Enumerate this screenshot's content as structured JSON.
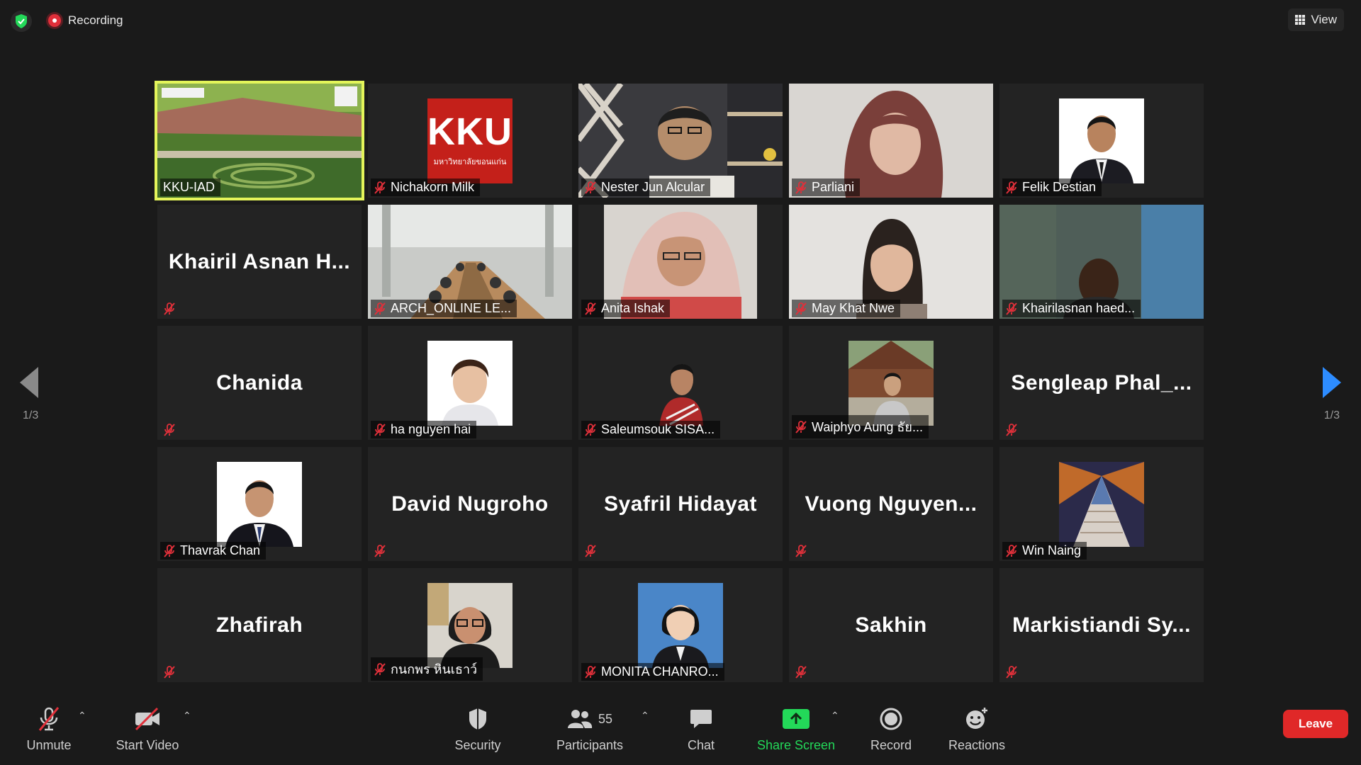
{
  "header": {
    "recording_label": "Recording",
    "view_label": "View"
  },
  "pagination": {
    "left": "1/3",
    "right": "1/3"
  },
  "participants": [
    {
      "name": "KKU-IAD",
      "kind": "video"
    },
    {
      "name": "Nichakorn Milk",
      "kind": "logo",
      "logo_text": "KKU",
      "logo_sub": "มหาวิทยาลัยขอนแก่น"
    },
    {
      "name": "Nester Jun Alcular",
      "kind": "video"
    },
    {
      "name": "Parliani",
      "kind": "video"
    },
    {
      "name": "Felik Destian",
      "kind": "photo"
    },
    {
      "name": "",
      "kind": "text",
      "display": "Khairil Asnan H..."
    },
    {
      "name": "ARCH_ONLINE LE...",
      "kind": "video"
    },
    {
      "name": "Anita Ishak",
      "kind": "video"
    },
    {
      "name": "May Khat Nwe",
      "kind": "video"
    },
    {
      "name": "Khairilasnan haed...",
      "kind": "video"
    },
    {
      "name": "",
      "kind": "text",
      "display": "Chanida"
    },
    {
      "name": "ha nguyen hai",
      "kind": "photo"
    },
    {
      "name": "Saleumsouk SISA...",
      "kind": "photo"
    },
    {
      "name": "Waiphyo Aung ธัย...",
      "kind": "photo"
    },
    {
      "name": "",
      "kind": "text",
      "display": "Sengleap  Phal_..."
    },
    {
      "name": "Thavrak Chan",
      "kind": "photo"
    },
    {
      "name": "",
      "kind": "text",
      "display": "David Nugroho"
    },
    {
      "name": "",
      "kind": "text",
      "display": "Syafril Hidayat"
    },
    {
      "name": "",
      "kind": "text",
      "display": "Vuong  Nguyen..."
    },
    {
      "name": "Win Naing",
      "kind": "photo"
    },
    {
      "name": "",
      "kind": "text",
      "display": "Zhafirah"
    },
    {
      "name": "กนกพร หินเธาว์",
      "kind": "photo"
    },
    {
      "name": "MONITA CHANRO...",
      "kind": "photo"
    },
    {
      "name": "",
      "kind": "text",
      "display": "Sakhin"
    },
    {
      "name": "",
      "kind": "text",
      "display": "Markistiandi  Sy..."
    }
  ],
  "toolbar": {
    "unmute": "Unmute",
    "start_video": "Start Video",
    "security": "Security",
    "participants": "Participants",
    "participants_count": "55",
    "chat": "Chat",
    "share_screen": "Share Screen",
    "record": "Record",
    "reactions": "Reactions",
    "leave": "Leave"
  },
  "colors": {
    "accent_blue": "#2d8cff",
    "share_green": "#23d959",
    "leave_red": "#e02828",
    "active_speaker": "#e4f55a",
    "mute_red": "#e0303a"
  }
}
